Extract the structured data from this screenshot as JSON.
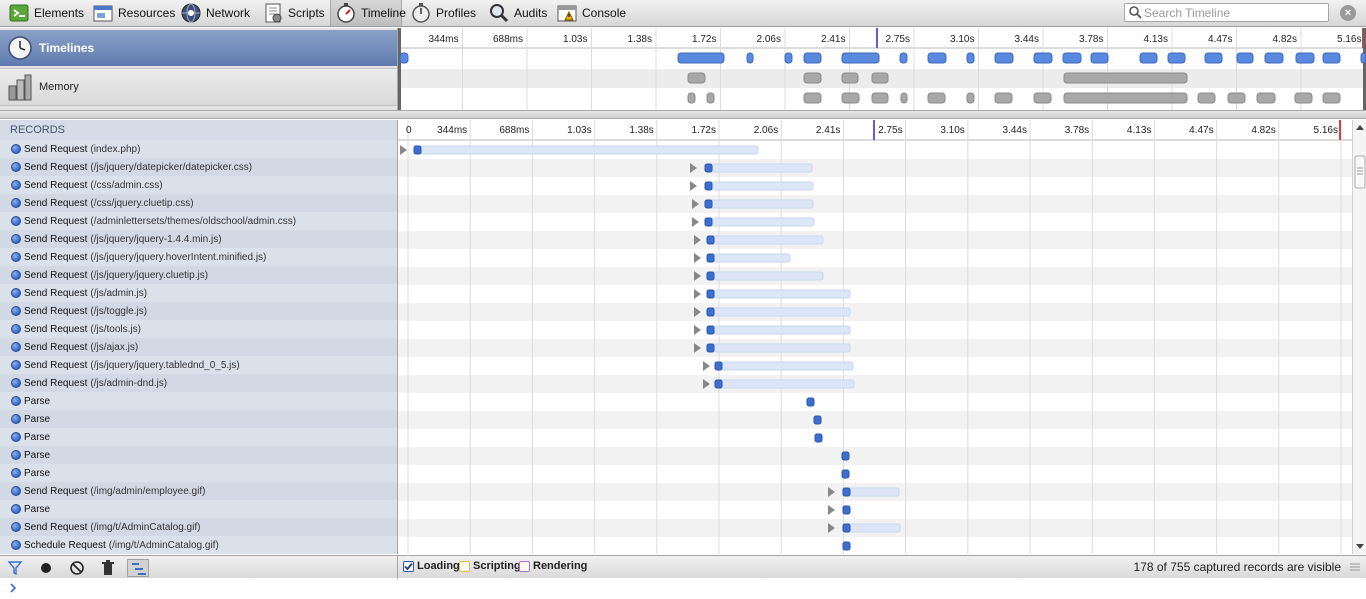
{
  "toolbar": {
    "tabs": [
      {
        "label": "Elements"
      },
      {
        "label": "Resources"
      },
      {
        "label": "Network"
      },
      {
        "label": "Scripts"
      },
      {
        "label": "Timeline"
      },
      {
        "label": "Profiles"
      },
      {
        "label": "Audits"
      },
      {
        "label": "Console"
      }
    ],
    "selected_tab": "Timeline",
    "search_placeholder": "Search Timeline"
  },
  "overview": {
    "timelines_label": "Timelines",
    "memory_label": "Memory",
    "ticks": [
      "344ms",
      "688ms",
      "1.03s",
      "1.38s",
      "1.72s",
      "2.06s",
      "2.41s",
      "2.75s",
      "3.10s",
      "3.44s",
      "3.78s",
      "4.13s",
      "4.47s",
      "4.82s",
      "5.16s"
    ]
  },
  "records": {
    "header": "RECORDS",
    "ticks": [
      "0",
      "344ms",
      "688ms",
      "1.03s",
      "1.38s",
      "1.72s",
      "2.06s",
      "2.41s",
      "2.75s",
      "3.10s",
      "3.44s",
      "3.78s",
      "4.13s",
      "4.47s",
      "4.82s",
      "5.16s"
    ],
    "items": [
      {
        "title": "Send Request",
        "detail": "(index.php)"
      },
      {
        "title": "Send Request",
        "detail": "(/js/jquery/datepicker/datepicker.css)"
      },
      {
        "title": "Send Request",
        "detail": "(/css/admin.css)"
      },
      {
        "title": "Send Request",
        "detail": "(/css/jquery.cluetip.css)"
      },
      {
        "title": "Send Request",
        "detail": "(/adminlettersets/themes/oldschool/admin.css)"
      },
      {
        "title": "Send Request",
        "detail": "(/js/jquery/jquery-1.4.4.min.js)"
      },
      {
        "title": "Send Request",
        "detail": "(/js/jquery/jquery.hoverIntent.minified.js)"
      },
      {
        "title": "Send Request",
        "detail": "(/js/jquery/jquery.cluetip.js)"
      },
      {
        "title": "Send Request",
        "detail": "(/js/admin.js)"
      },
      {
        "title": "Send Request",
        "detail": "(/js/toggle.js)"
      },
      {
        "title": "Send Request",
        "detail": "(/js/tools.js)"
      },
      {
        "title": "Send Request",
        "detail": "(/js/ajax.js)"
      },
      {
        "title": "Send Request",
        "detail": "(/js/jquery/jquery.tablednd_0_5.js)"
      },
      {
        "title": "Send Request",
        "detail": "(/js/admin-dnd.js)"
      },
      {
        "title": "Parse",
        "detail": ""
      },
      {
        "title": "Parse",
        "detail": ""
      },
      {
        "title": "Parse",
        "detail": ""
      },
      {
        "title": "Parse",
        "detail": ""
      },
      {
        "title": "Parse",
        "detail": ""
      },
      {
        "title": "Send Request",
        "detail": "(/img/admin/employee.gif)"
      },
      {
        "title": "Parse",
        "detail": ""
      },
      {
        "title": "Send Request",
        "detail": "(/img/t/AdminCatalog.gif)"
      },
      {
        "title": "Schedule Request",
        "detail": "(/img/t/AdminCatalog.gif)"
      }
    ]
  },
  "statusbar": {
    "filters": [
      {
        "label": "Loading",
        "checked": true,
        "color": "#5a8ae0"
      },
      {
        "label": "Scripting",
        "checked": false,
        "color": "#e8b93e"
      },
      {
        "label": "Rendering",
        "checked": false,
        "color": "#b070d8"
      }
    ],
    "count_text": "178 of 755 captured records are visible"
  },
  "colors": {
    "loading": "#5a8ae0",
    "bar_fill": "#dce6f6",
    "dot": "#3c6fd0"
  }
}
